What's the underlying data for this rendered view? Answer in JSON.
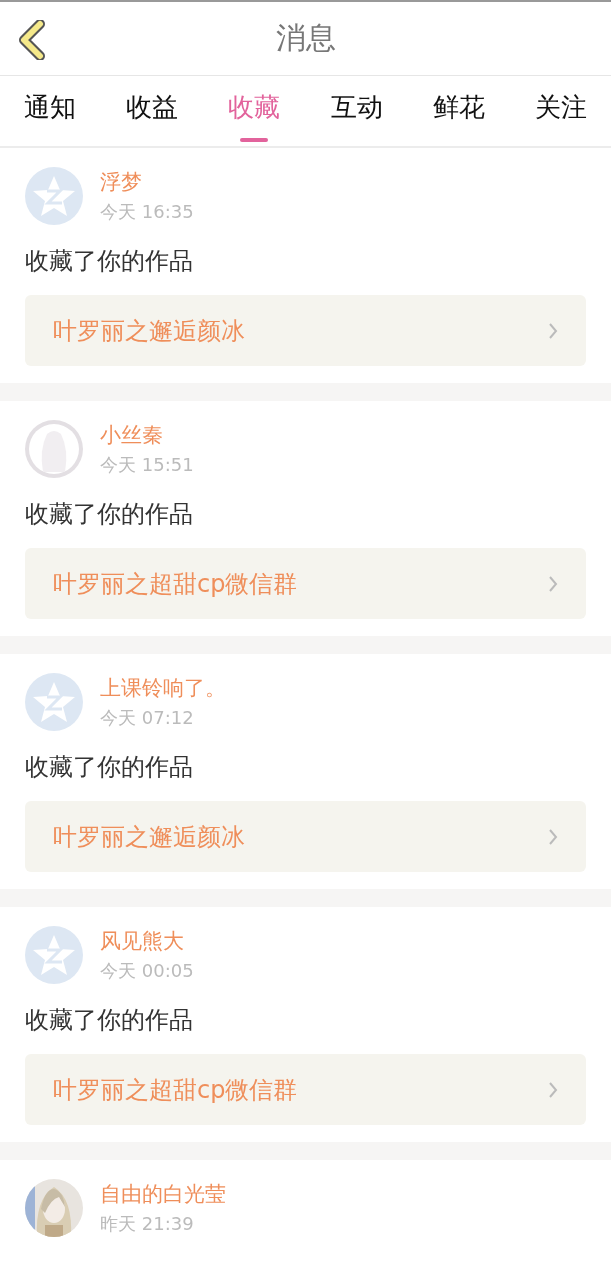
{
  "header": {
    "title": "消息"
  },
  "tabs": [
    {
      "label": "通知",
      "selected": false
    },
    {
      "label": "收益",
      "selected": false
    },
    {
      "label": "收藏",
      "selected": true
    },
    {
      "label": "互动",
      "selected": false
    },
    {
      "label": "鲜花",
      "selected": false
    },
    {
      "label": "关注",
      "selected": false
    }
  ],
  "messages": [
    {
      "kind": "default",
      "name": "浮梦",
      "time": "今天 16:35",
      "action": "收藏了你的作品",
      "work": "叶罗丽之邂逅颜冰"
    },
    {
      "kind": "silhouette",
      "name": "小丝秦",
      "time": "今天 15:51",
      "action": "收藏了你的作品",
      "work": "叶罗丽之超甜cp微信群"
    },
    {
      "kind": "default",
      "name": "上课铃响了。",
      "time": "今天 07:12",
      "action": "收藏了你的作品",
      "work": "叶罗丽之邂逅颜冰"
    },
    {
      "kind": "default",
      "name": "风见熊大",
      "time": "今天 00:05",
      "action": "收藏了你的作品",
      "work": "叶罗丽之超甜cp微信群"
    },
    {
      "kind": "picture",
      "name": "自由的白光莹",
      "time": "昨天 21:39"
    }
  ]
}
